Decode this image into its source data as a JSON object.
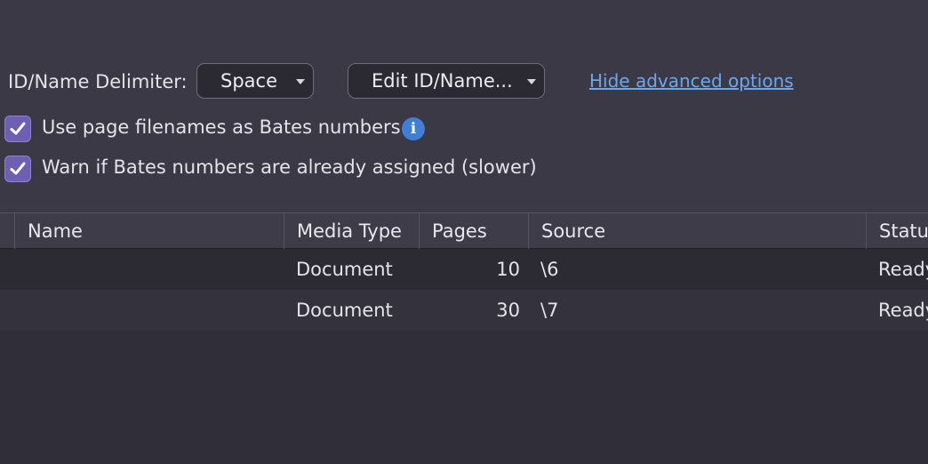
{
  "options": {
    "delimiter_label": "ID/Name Delimiter:",
    "delimiter_value": "Space",
    "edit_button_label": "Edit ID/Name...",
    "advanced_link": "Hide advanced options",
    "checkboxes": [
      {
        "label": "Use page filenames as Bates numbers",
        "checked": true
      },
      {
        "label": "Warn if Bates numbers are already assigned (slower)",
        "checked": true
      }
    ]
  },
  "table": {
    "columns": [
      "Name",
      "Media Type",
      "Pages",
      "Source",
      "Status"
    ],
    "rows": [
      {
        "name": "",
        "media_type": "Document",
        "pages": "10",
        "source": "\\6",
        "status": "Ready"
      },
      {
        "name": "",
        "media_type": "Document",
        "pages": "30",
        "source": "\\7",
        "status": "Ready"
      }
    ]
  },
  "colors": {
    "background": "#3a3945",
    "accent_checkbox": "#6e5fb3",
    "link": "#6aa8ee",
    "info_icon": "#3f7fd6"
  }
}
